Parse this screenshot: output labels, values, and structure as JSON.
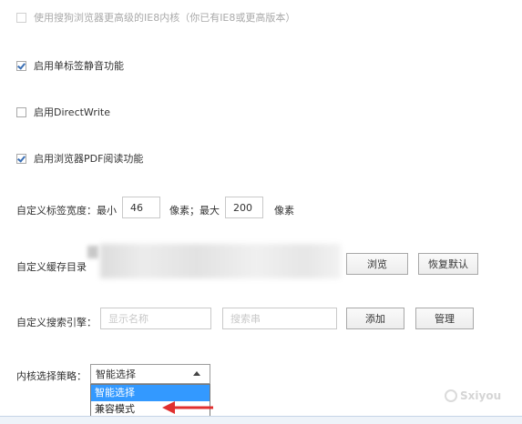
{
  "options": {
    "ie8_kernel": {
      "label": "使用搜狗浏览器更高级的IE8内核（你已有IE8或更高版本）",
      "checked": false,
      "disabled": true
    },
    "tab_mute": {
      "label": "启用单标签静音功能",
      "checked": true
    },
    "directwrite": {
      "label": "启用DirectWrite",
      "checked": false
    },
    "pdf_reader": {
      "label": "启用浏览器PDF阅读功能",
      "checked": true
    }
  },
  "tab_width": {
    "label": "自定义标签宽度：最小",
    "min_value": "46",
    "mid_label": "像素；最大",
    "max_value": "200",
    "unit": "像素"
  },
  "cache_dir": {
    "label": "自定义缓存目录",
    "browse_label": "浏览",
    "restore_label": "恢复默认"
  },
  "search_engine": {
    "label": "自定义搜索引擎：",
    "name_placeholder": "显示名称",
    "query_placeholder": "搜索串",
    "add_label": "添加",
    "manage_label": "管理"
  },
  "kernel_policy": {
    "label": "内核选择策略：",
    "selected": "智能选择",
    "options": [
      "智能选择",
      "兼容模式"
    ]
  },
  "colors": {
    "accent": "#3399ff",
    "arrow": "#e03030",
    "check": "#3a6fb5"
  }
}
